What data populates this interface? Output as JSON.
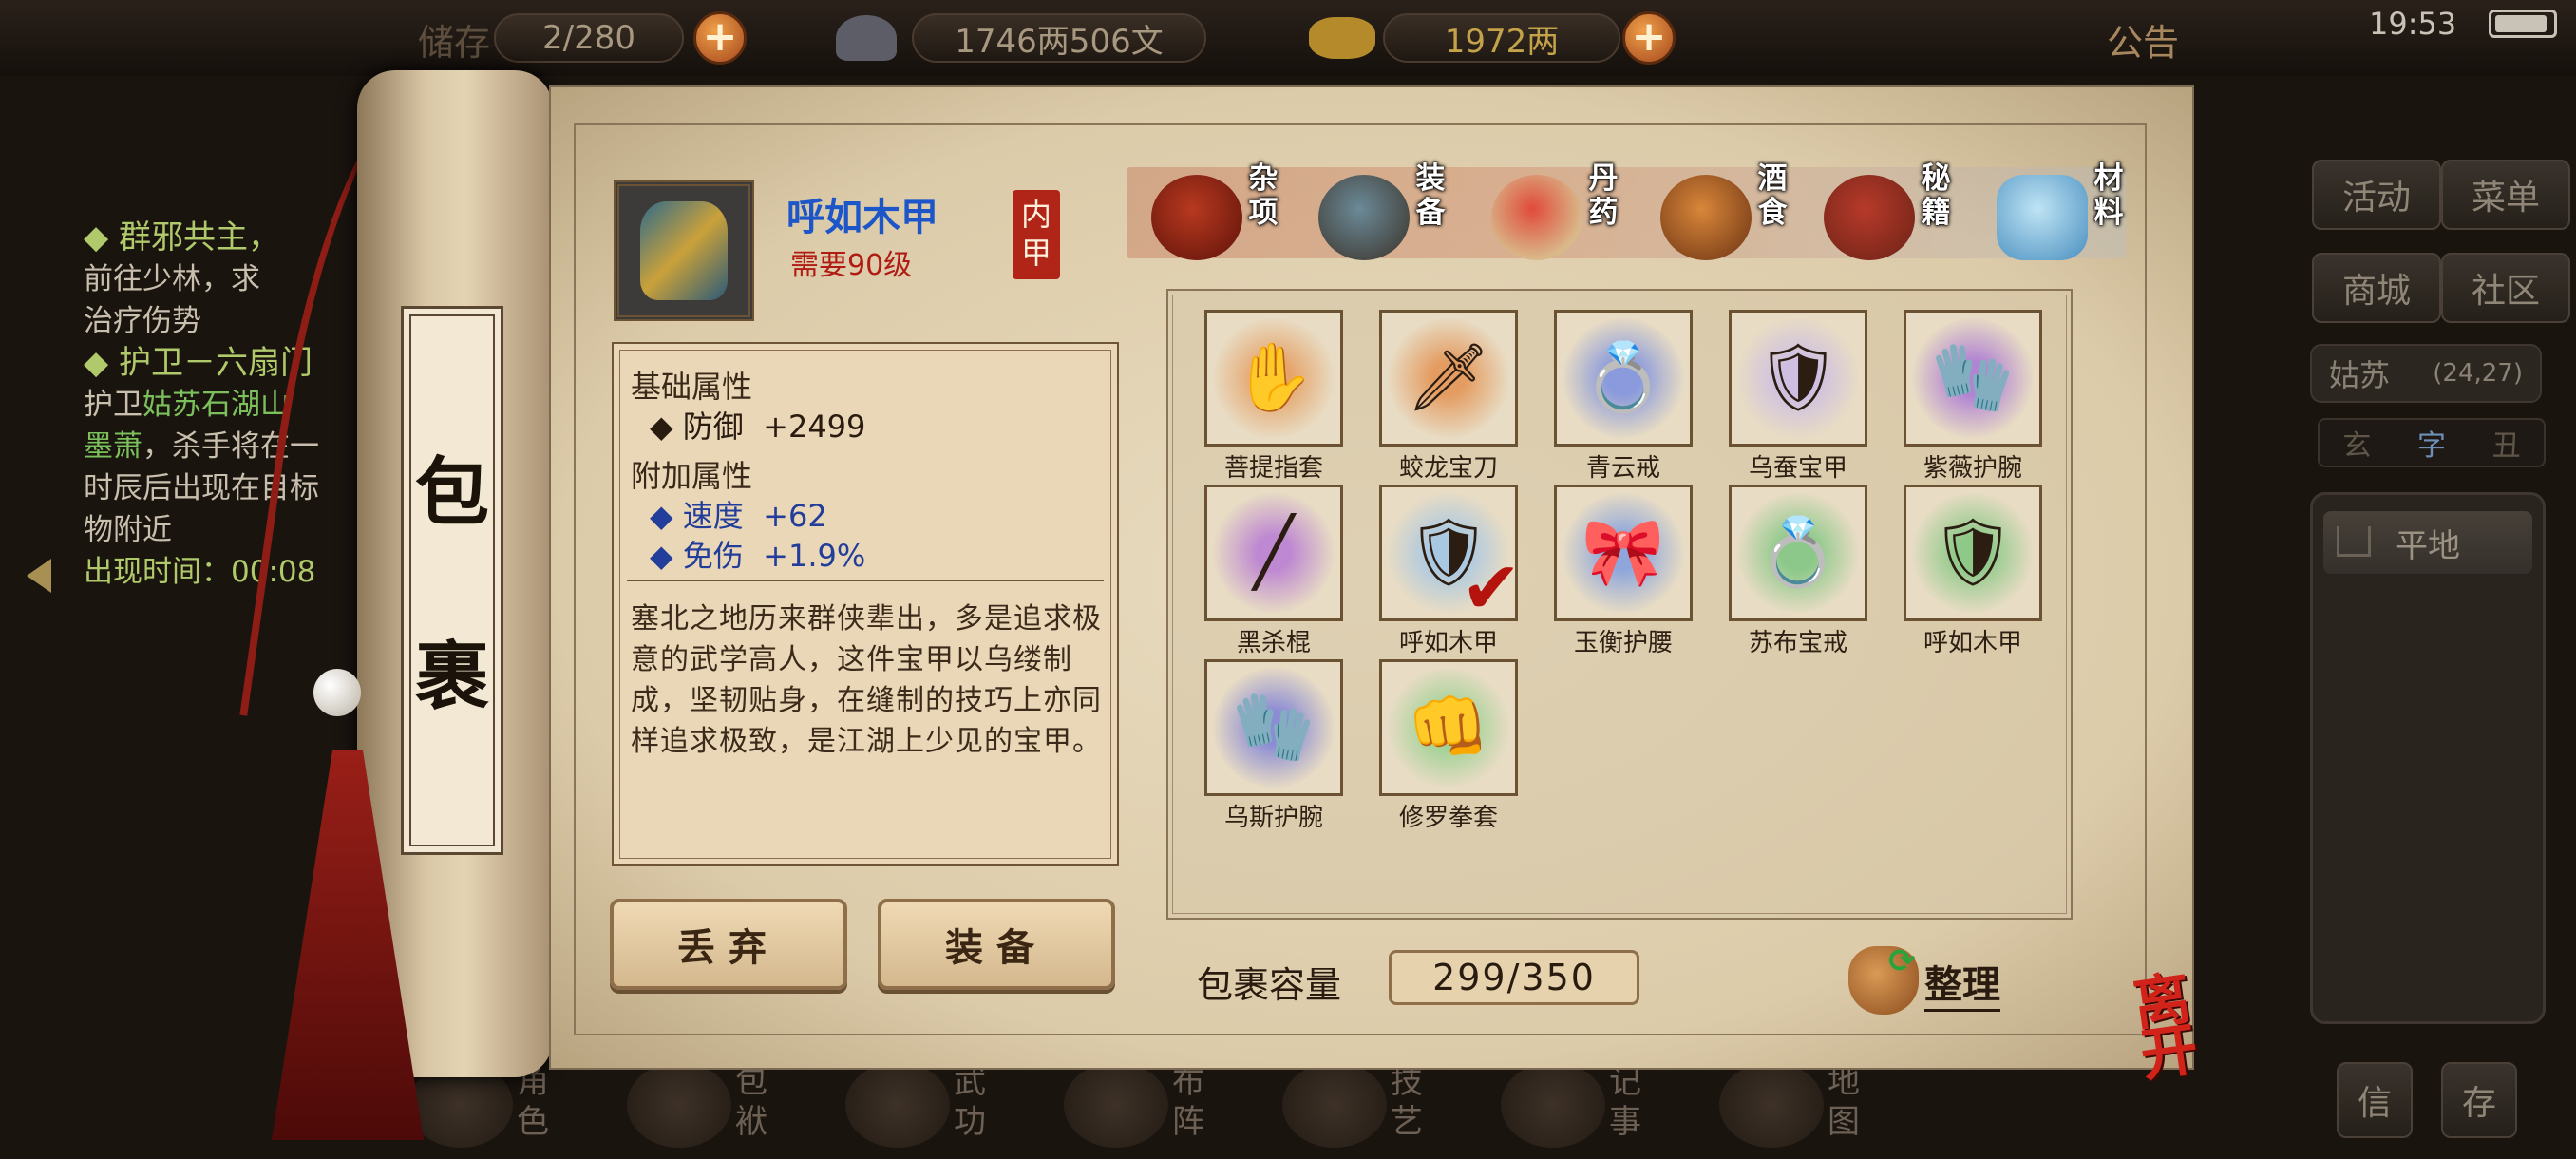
{
  "topbar": {
    "storage_label": "储存",
    "storage_value": "2/280",
    "money": "1746两506文",
    "gold": "1972两",
    "announcement": "公告",
    "time": "19:53"
  },
  "quest_log": {
    "quest1_title": "◆ 群邪共主，",
    "quest1_desc": [
      "前往少林，求",
      "治疗伤势"
    ],
    "quest2_title": "◆ 护卫－六扇门",
    "quest2_line1_pre": "护卫",
    "quest2_line1_hl": "姑苏石湖山",
    "quest2_line2_hl": "墨萧",
    "quest2_line2_post": "，杀手将在一",
    "quest2_line3": "时辰后出现在目标",
    "quest2_line4": "物附近",
    "quest2_time": "出现时间：00:08"
  },
  "right_panel": {
    "buttons": [
      "活动",
      "菜单",
      "商城",
      "社区"
    ],
    "location_name": "姑苏",
    "location_coords": "(24,27)",
    "minimap_tabs": [
      "玄",
      "字",
      "丑"
    ],
    "plain_button": "平地",
    "bottom_buttons": [
      "信",
      "存"
    ]
  },
  "bottom_nav": [
    "角色",
    "包袱",
    "武功",
    "布阵",
    "技艺",
    "记事",
    "地图"
  ],
  "scroll": {
    "title_chars": [
      "包",
      "裹"
    ]
  },
  "item": {
    "name": "呼如木甲",
    "required_level": "需要90级",
    "type_seal": "内甲",
    "base_header": "基础属性",
    "base_attrs": [
      {
        "name": "防御",
        "value": "+2499"
      }
    ],
    "bonus_header": "附加属性",
    "bonus_attrs": [
      {
        "name": "速度",
        "value": "+62"
      },
      {
        "name": "免伤",
        "value": "+1.9%"
      }
    ],
    "description": "塞北之地历来群侠辈出，多是追求极意的武学高人，这件宝甲以乌缕制成，坚韧贴身，在缝制的技巧上亦同样追求极致，是江湖上少见的宝甲。"
  },
  "actions": {
    "discard": "丢弃",
    "equip": "装备"
  },
  "tabs": [
    {
      "label": "杂项",
      "icon": "jar-icon"
    },
    {
      "label": "装备",
      "icon": "equipment-icon"
    },
    {
      "label": "丹药",
      "icon": "pills-icon"
    },
    {
      "label": "酒食",
      "icon": "food-icon"
    },
    {
      "label": "秘籍",
      "icon": "book-icon"
    },
    {
      "label": "材料",
      "icon": "crystal-icon"
    }
  ],
  "inventory": [
    {
      "name": "菩提指套",
      "icon": "finger-guard-icon",
      "aura": "#e59a5a",
      "glyph": "✋"
    },
    {
      "name": "蛟龙宝刀",
      "icon": "saber-icon",
      "aura": "#e39150",
      "glyph": "🗡"
    },
    {
      "name": "青云戒",
      "icon": "ring-icon",
      "aura": "#7a8fe0",
      "glyph": "💍"
    },
    {
      "name": "乌蚕宝甲",
      "icon": "armor-icon",
      "aura": "#c9b9e8",
      "glyph": "🛡"
    },
    {
      "name": "紫薇护腕",
      "icon": "bracer-icon",
      "aura": "#a774d6",
      "glyph": "🧤"
    },
    {
      "name": "黑杀棍",
      "icon": "staff-icon",
      "aura": "#b77ad4",
      "glyph": "╱"
    },
    {
      "name": "呼如木甲",
      "icon": "armor-icon",
      "aura": "#9dc4e8",
      "glyph": "🛡",
      "equipped": true
    },
    {
      "name": "玉衡护腰",
      "icon": "belt-icon",
      "aura": "#7e9de0",
      "glyph": "🎀"
    },
    {
      "name": "苏布宝戒",
      "icon": "ring-icon",
      "aura": "#7bc57f",
      "glyph": "💍"
    },
    {
      "name": "呼如木甲",
      "icon": "armor-icon",
      "aura": "#7fc67f",
      "glyph": "🛡"
    },
    {
      "name": "乌斯护腕",
      "icon": "bracer-icon",
      "aura": "#7b7ed8",
      "glyph": "🧤"
    },
    {
      "name": "修罗拳套",
      "icon": "gauntlet-icon",
      "aura": "#8fcf8a",
      "glyph": "👊"
    }
  ],
  "capacity": {
    "label": "包裹容量",
    "value": "299/350"
  },
  "sort_label": "整理",
  "leave_label": "离开",
  "colors": {
    "item_name": "#1d56c8",
    "required_level": "#b01c14",
    "bonus_attr": "#223e9a",
    "quest_title": "#b0c96a"
  }
}
